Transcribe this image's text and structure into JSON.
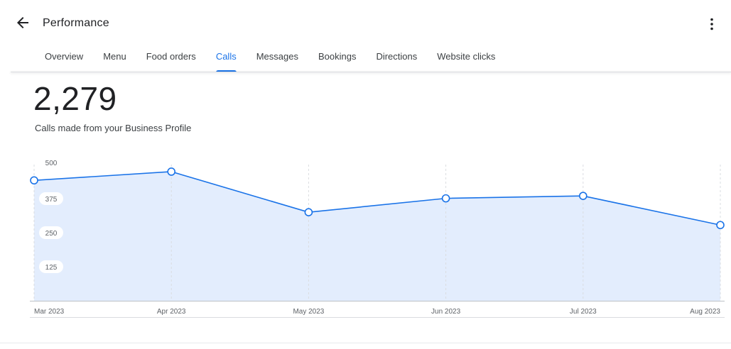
{
  "header": {
    "title": "Performance",
    "back_icon": "arrow-left-icon",
    "more_icon": "more-vert-icon"
  },
  "tabs": [
    {
      "label": "Overview",
      "active": false
    },
    {
      "label": "Menu",
      "active": false
    },
    {
      "label": "Food orders",
      "active": false
    },
    {
      "label": "Calls",
      "active": true
    },
    {
      "label": "Messages",
      "active": false
    },
    {
      "label": "Bookings",
      "active": false
    },
    {
      "label": "Directions",
      "active": false
    },
    {
      "label": "Website clicks",
      "active": false
    }
  ],
  "summary": {
    "total": "2,279",
    "description": "Calls made from your Business Profile"
  },
  "colors": {
    "accent": "#1a73e8",
    "line": "#1a73e8",
    "area_fill": "#e3edfd"
  },
  "chart_data": {
    "type": "area",
    "x": [
      "Mar 2023",
      "Apr 2023",
      "May 2023",
      "Jun 2023",
      "Jul 2023",
      "Aug 2023"
    ],
    "series": [
      {
        "values": [
          442,
          474,
          325,
          376,
          385,
          278
        ]
      }
    ],
    "ylim": [
      0,
      500
    ],
    "yticks": [
      "500",
      "375",
      "250",
      "125"
    ],
    "grid": "vertical-dashed"
  }
}
